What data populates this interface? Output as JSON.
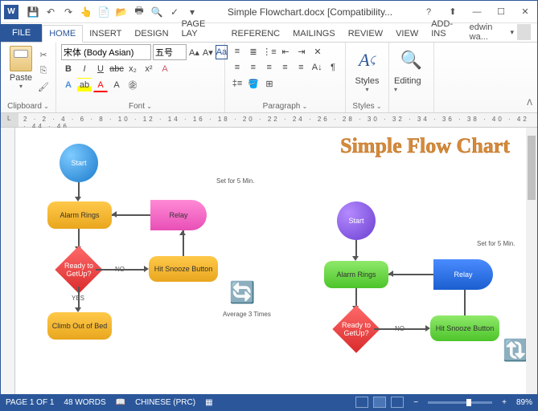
{
  "title": "Simple Flowchart.docx [Compatibility...",
  "qat": {
    "save": "💾",
    "undo": "↶",
    "redo": "↷",
    "touch": "👆",
    "new": "📄",
    "open": "📂",
    "print": "🖶",
    "preview": "🔍",
    "spell": "✓",
    "dd": "▾"
  },
  "window": {
    "help": "?",
    "up": "⬆",
    "min": "—",
    "max": "☐",
    "close": "✕"
  },
  "tabs": {
    "file": "FILE",
    "home": "HOME",
    "insert": "INSERT",
    "design": "DESIGN",
    "pagelayout": "PAGE LAY",
    "references": "REFERENC",
    "mailings": "MAILINGS",
    "review": "REVIEW",
    "view": "VIEW",
    "addins": "ADD-INS"
  },
  "user": "edwin wa...",
  "ribbon": {
    "paste": "Paste",
    "clipboard": "Clipboard",
    "font": "Font",
    "paragraph": "Paragraph",
    "styles": "Styles",
    "editing": "Editing",
    "font_name": "宋体 (Body Asian)",
    "font_size": "五号"
  },
  "status": {
    "page": "PAGE 1 OF 1",
    "words": "48 WORDS",
    "lang": "CHINESE (PRC)",
    "zoom": "89%"
  },
  "doc": {
    "title": "Simple Flow Chart",
    "start": "Start",
    "alarm": "Alarm Rings",
    "relay": "Relay",
    "ready": "Ready to GetUp?",
    "snooze": "Hit Snooze Button",
    "climb": "Climb Out of Bed",
    "no": "NO",
    "yes": "YES",
    "set5": "Set for 5 Min.",
    "avg": "Average 3 Times"
  },
  "ruler_numbers": "2  ·  2  ·  4  ·  6  ·  8  ·  10  ·  12  ·  14  ·  16  ·  18  ·  20  ·  22  ·  24  ·  26  ·  28  ·  30  ·  32  ·  34  ·  36  ·  38  ·  40  ·  42  ·  44  ·  46"
}
